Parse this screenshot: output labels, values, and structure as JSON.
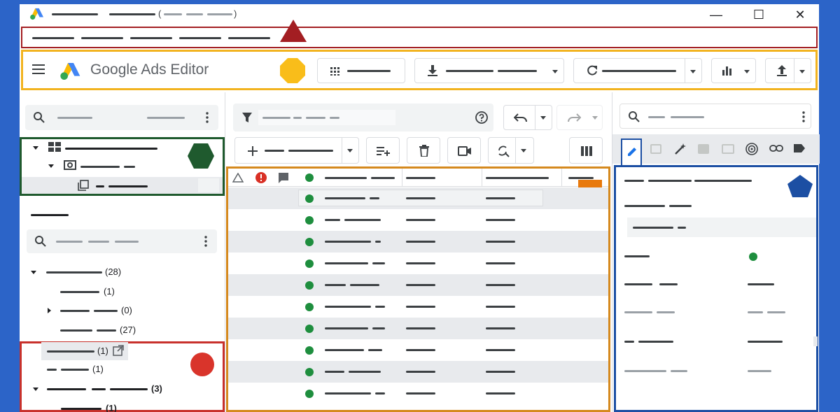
{
  "app": {
    "title": "Google Ads Editor",
    "brand_colors": {
      "blue": "#4285f4",
      "yellow": "#fbbc04",
      "green": "#34a853"
    }
  },
  "window_controls": {
    "minimize": "—",
    "maximize": "☐",
    "close": "✕"
  },
  "left_panel": {
    "tree_counts": [
      "(28)",
      "(1)",
      "(0)",
      "(27)",
      "(1)",
      "(1)",
      "(3)",
      "(1)"
    ]
  },
  "icons": {
    "menu": "hamburger-icon",
    "grid": "grid-icon",
    "download": "download-icon",
    "refresh": "refresh-icon",
    "stats": "bar-chart-icon",
    "upload": "upload-icon",
    "search": "search-icon",
    "filter": "filter-icon",
    "help": "help-icon",
    "undo": "undo-icon",
    "redo": "redo-icon",
    "add": "plus-icon",
    "delete": "trash-icon",
    "video": "video-icon",
    "columns": "columns-icon",
    "edit": "pencil-icon"
  },
  "annotation_colors": {
    "menu_box": "#a31e22",
    "toolbar_box": "#f2b31f",
    "tree_box": "#1f5a2e",
    "lower_tree_box": "#c8312c",
    "grid_box": "#d5891e",
    "editor_box": "#1c4fa3"
  },
  "status_color": "#1e8e3e",
  "error_color": "#d93025"
}
